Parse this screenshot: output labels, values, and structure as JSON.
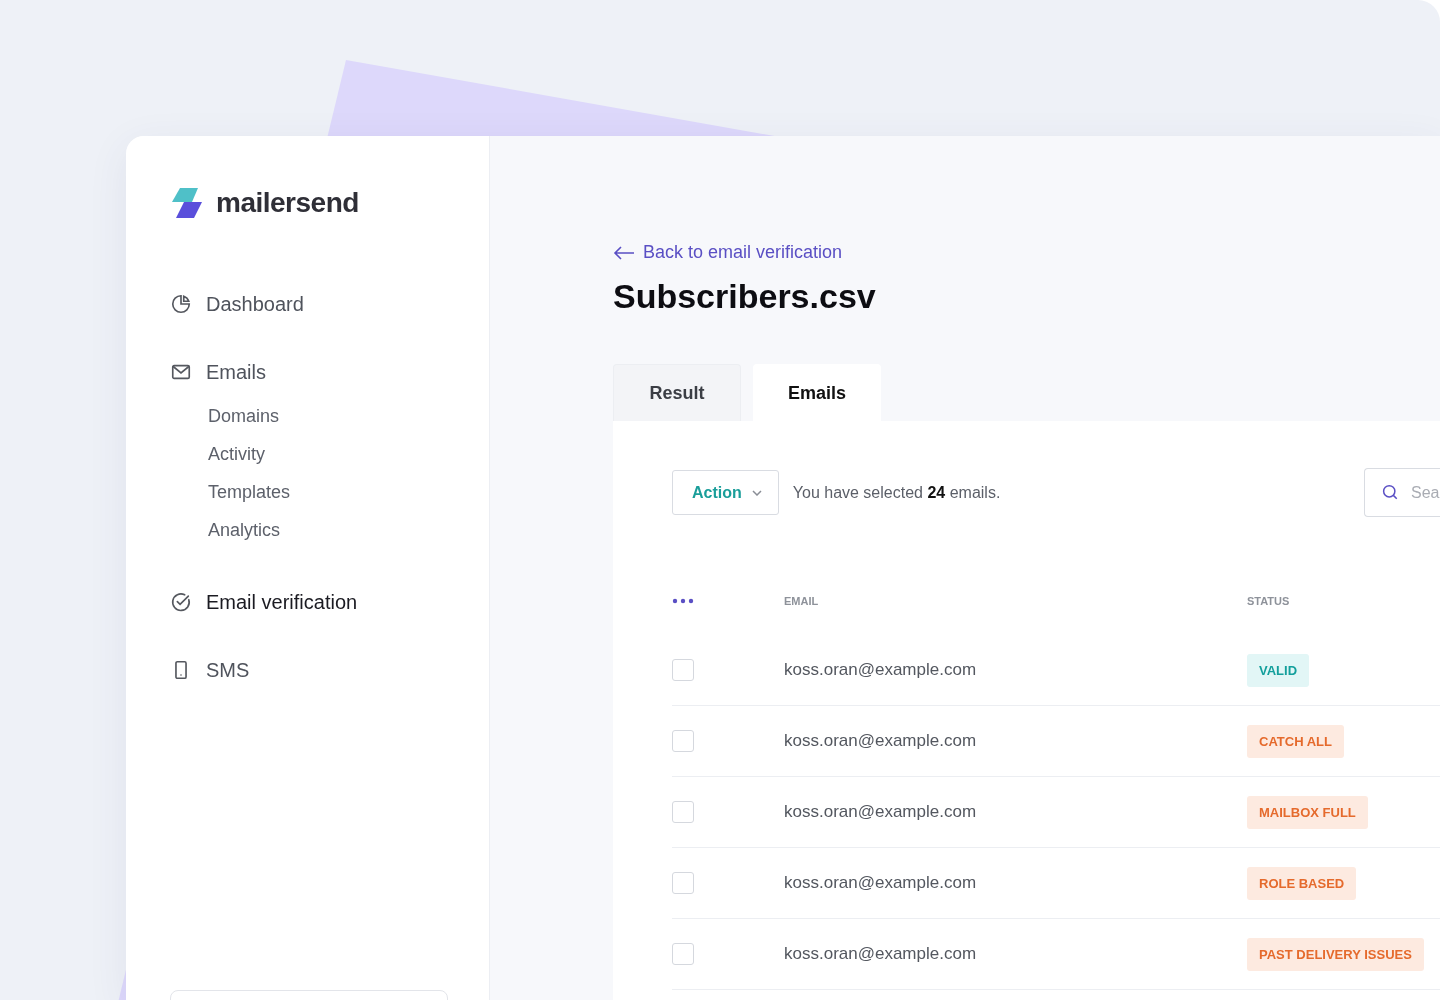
{
  "brand": {
    "name": "mailersend"
  },
  "sidebar": {
    "items": [
      {
        "label": "Dashboard",
        "kind": "pie",
        "selected": false
      },
      {
        "label": "Emails",
        "kind": "mail",
        "selected": false,
        "children": [
          {
            "label": "Domains",
            "selected": false
          },
          {
            "label": "Activity",
            "selected": false
          },
          {
            "label": "Templates",
            "selected": false
          },
          {
            "label": "Analytics",
            "selected": false
          }
        ]
      },
      {
        "label": "Email verification",
        "kind": "check",
        "selected": true
      },
      {
        "label": "SMS",
        "kind": "phone",
        "selected": false
      }
    ]
  },
  "back_link": "Back to email verification",
  "title": "Subscribers.csv",
  "tabs": [
    {
      "label": "Result",
      "selected": false
    },
    {
      "label": "Emails",
      "selected": true
    }
  ],
  "toolbar": {
    "action": "Action",
    "selection_text": "You have selected **24** emails.",
    "search": {
      "placeholder": "Sea"
    }
  },
  "table": {
    "columns": [
      "EMAIL",
      "STATUS"
    ],
    "rows": [
      {
        "checked": false,
        "email": "koss.oran@example.com",
        "status": {
          "label": "VALID",
          "kind": "valid"
        }
      },
      {
        "checked": false,
        "email": "koss.oran@example.com",
        "status": {
          "label": "CATCH ALL",
          "kind": "warning"
        }
      },
      {
        "checked": false,
        "email": "koss.oran@example.com",
        "status": {
          "label": "MAILBOX FULL",
          "kind": "warning"
        }
      },
      {
        "checked": false,
        "email": "koss.oran@example.com",
        "status": {
          "label": "ROLE BASED",
          "kind": "warning"
        }
      },
      {
        "checked": false,
        "email": "koss.oran@example.com",
        "status": {
          "label": "PAST DELIVERY ISSUES",
          "kind": "warning"
        }
      }
    ]
  }
}
